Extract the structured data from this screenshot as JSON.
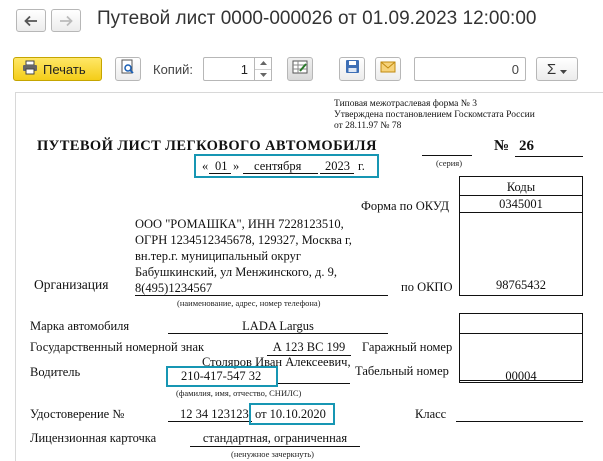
{
  "window": {
    "title": "Путевой лист 0000-000026 от 01.09.2023 12:00:00"
  },
  "toolbar": {
    "print_label": "Печать",
    "copies_label": "Копий:",
    "copies_value": "1",
    "number_value": "0",
    "sum_symbol": "Σ"
  },
  "document": {
    "form_note": [
      "Типовая межотраслевая форма № 3",
      "Утверждена постановлением Госкомстата России",
      "от 28.11.97  № 78"
    ],
    "heading": "ПУТЕВОЙ ЛИСТ ЛЕГКОВОГО АВТОМОБИЛЯ",
    "number_label": "№",
    "number": "26",
    "series_caption": "(серия)",
    "date": {
      "open_quote": "«",
      "day": "01",
      "close_quote": "»",
      "month": "сентября",
      "year": "2023",
      "year_suffix": "г."
    },
    "codes_header": "Коды",
    "okud_label": "Форма по ОКУД",
    "okud_code": "0345001",
    "okpo_label": "по ОКПО",
    "okpo_code": "98765432",
    "org_label": "Организация",
    "org_lines": [
      "ООО \"РОМАШКА\", ИНН 7228123510,",
      "ОГРН 1234512345678, 129327, Москва г,",
      "вн.тер.г. муниципальный округ",
      "Бабушкинский, ул Менжинского, д. 9,",
      "8(495)1234567"
    ],
    "org_caption": "(наименование, адрес, номер телефона)",
    "car_label": "Марка автомобиля",
    "car_value": "LADA Largus",
    "plate_label": "Государственный номерной знак",
    "plate_value": "А 123 ВС 199",
    "garage_label": "Гаражный номер",
    "driver_label": "Водитель",
    "driver_name": "Столяров Иван Алексеевич,",
    "driver_snils": "210-417-547 32",
    "driver_caption": "(фамилия, имя, отчество, СНИЛС)",
    "tab_label": "Табельный номер",
    "tab_value": "00004",
    "license_label": "Удостоверение №",
    "license_number": "12 34 123123",
    "license_date": "от 10.10.2020",
    "class_label": "Класс",
    "card_label": "Лицензионная карточка",
    "card_value": "стандартная, ограниченная",
    "card_caption": "(ненужное зачеркнуть)"
  },
  "colors": {
    "highlight": "#1796b3",
    "print_button": "#f4cd18"
  }
}
